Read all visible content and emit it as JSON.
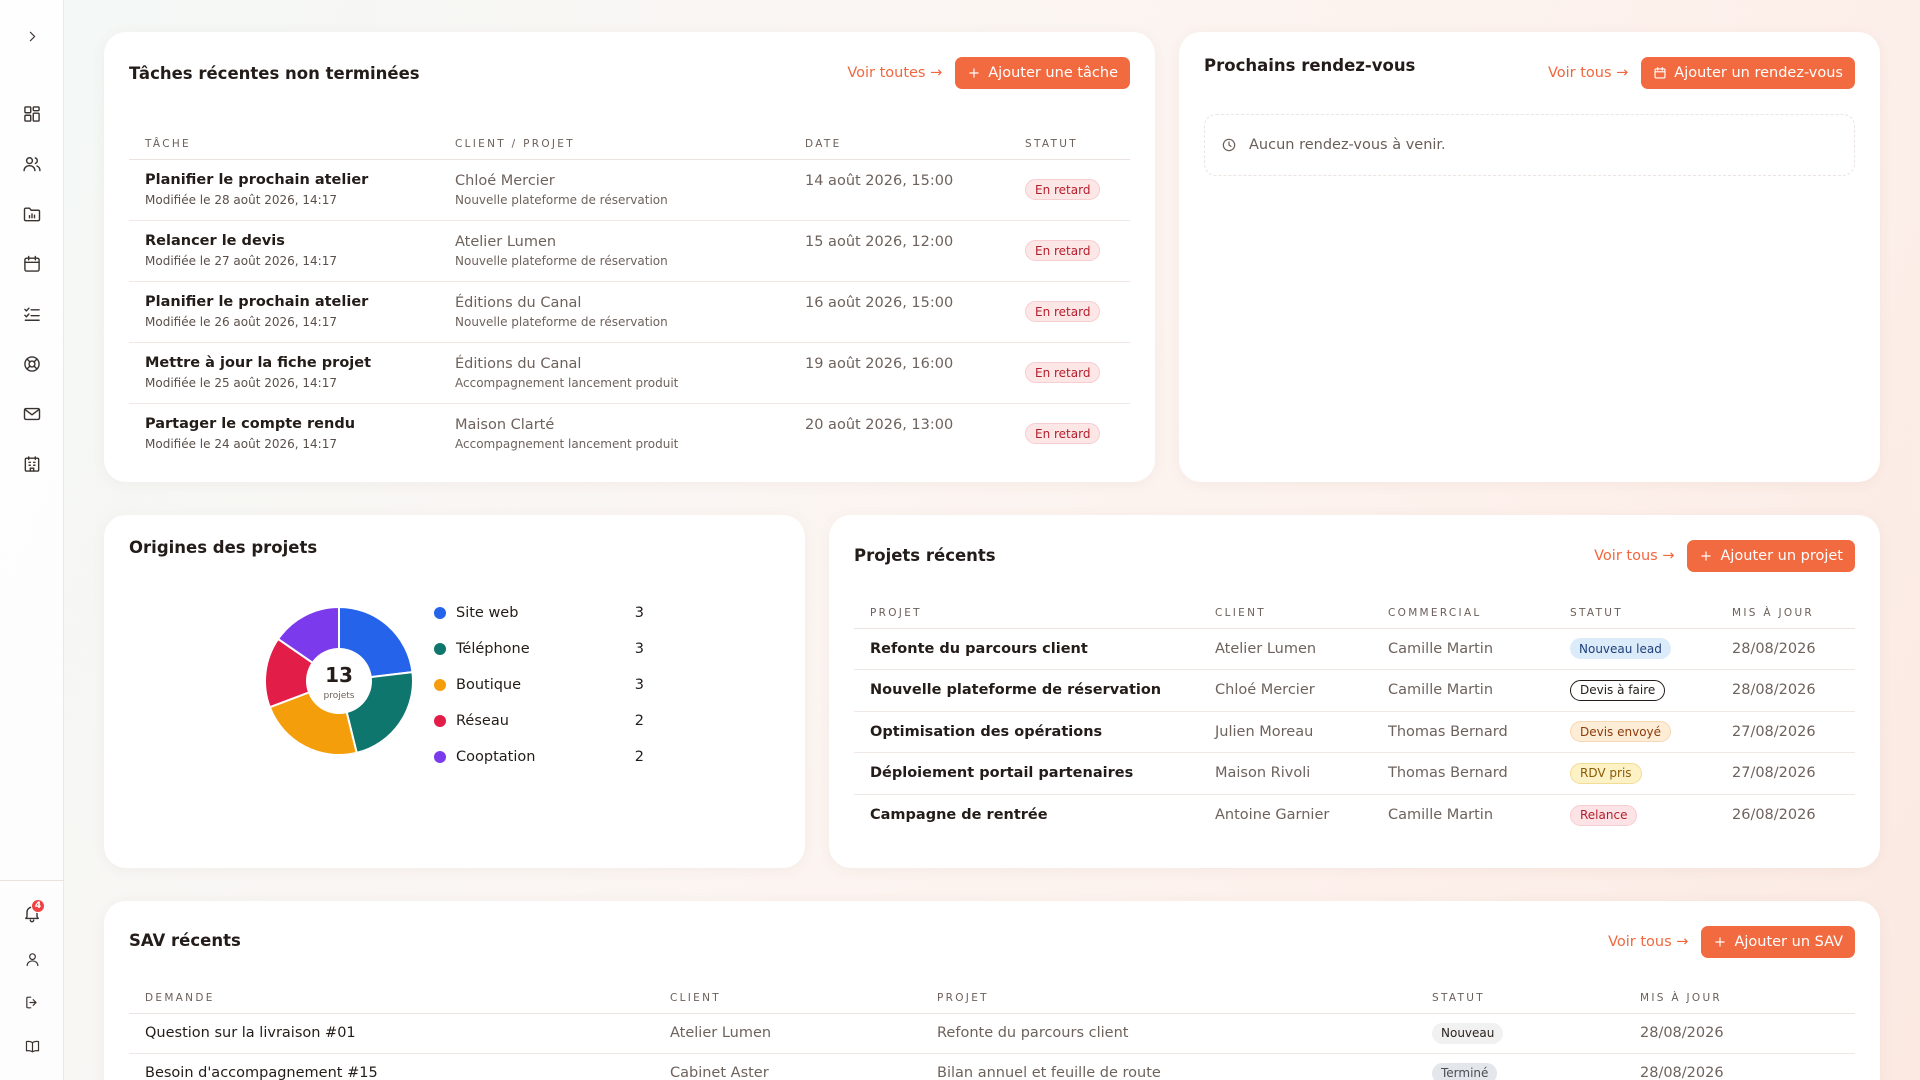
{
  "sidebar": {
    "toggle_icon": "chevron-right-icon",
    "nav": [
      {
        "icon": "dashboard-icon"
      },
      {
        "icon": "users-icon"
      },
      {
        "icon": "folder-chart-icon"
      },
      {
        "icon": "calendar-icon"
      },
      {
        "icon": "checklist-icon"
      },
      {
        "icon": "lifebuoy-icon"
      },
      {
        "icon": "mail-icon"
      },
      {
        "icon": "building-icon"
      }
    ],
    "notifications_count": "4",
    "bottom": [
      {
        "icon": "bell-icon"
      },
      {
        "icon": "user-icon"
      },
      {
        "icon": "logout-icon"
      },
      {
        "icon": "book-icon"
      }
    ]
  },
  "tasks": {
    "title": "Tâches récentes non terminées",
    "view_all": "Voir toutes →",
    "add_label": "Ajouter une tâche",
    "columns": [
      "TÂCHE",
      "CLIENT / PROJET",
      "DATE",
      "STATUT"
    ],
    "rows": [
      {
        "task": "Planifier le prochain atelier",
        "modified": "Modifiée le 28 août 2026, 14:17",
        "client": "Chloé Mercier",
        "project": "Nouvelle plateforme de réservation",
        "date": "14 août 2026, 15:00",
        "status": "En retard"
      },
      {
        "task": "Relancer le devis",
        "modified": "Modifiée le 27 août 2026, 14:17",
        "client": "Atelier Lumen",
        "project": "Nouvelle plateforme de réservation",
        "date": "15 août 2026, 12:00",
        "status": "En retard"
      },
      {
        "task": "Planifier le prochain atelier",
        "modified": "Modifiée le 26 août 2026, 14:17",
        "client": "Éditions du Canal",
        "project": "Nouvelle plateforme de réservation",
        "date": "16 août 2026, 15:00",
        "status": "En retard"
      },
      {
        "task": "Mettre à jour la fiche projet",
        "modified": "Modifiée le 25 août 2026, 14:17",
        "client": "Éditions du Canal",
        "project": "Accompagnement lancement produit",
        "date": "19 août 2026, 16:00",
        "status": "En retard"
      },
      {
        "task": "Partager le compte rendu",
        "modified": "Modifiée le 24 août 2026, 14:17",
        "client": "Maison Clarté",
        "project": "Accompagnement lancement produit",
        "date": "20 août 2026, 13:00",
        "status": "En retard"
      }
    ]
  },
  "appointments": {
    "title": "Prochains rendez-vous",
    "view_all": "Voir tous →",
    "add_label": "Ajouter un rendez-vous",
    "empty_text": "Aucun rendez-vous à venir."
  },
  "origins": {
    "title": "Origines des projets",
    "total": "13",
    "total_label": "projets",
    "colors": [
      "#2563eb",
      "#0f766e",
      "#f59e0b",
      "#e11d48",
      "#7c3aed"
    ]
  },
  "chart_data": {
    "type": "pie",
    "categories": [
      "Site web",
      "Téléphone",
      "Boutique",
      "Réseau",
      "Cooptation"
    ],
    "values": [
      3,
      3,
      3,
      2,
      2
    ]
  },
  "projects": {
    "title": "Projets récents",
    "view_all": "Voir tous →",
    "add_label": "Ajouter un projet",
    "columns": [
      "PROJET",
      "CLIENT",
      "COMMERCIAL",
      "STATUT",
      "MIS À JOUR"
    ],
    "rows": [
      {
        "project": "Refonte du parcours client",
        "client": "Atelier Lumen",
        "sales": "Camille Martin",
        "status": "Nouveau lead",
        "status_kind": "lead",
        "updated": "28/08/2026"
      },
      {
        "project": "Nouvelle plateforme de réservation",
        "client": "Chloé Mercier",
        "sales": "Camille Martin",
        "status": "Devis à faire",
        "status_kind": "devis",
        "updated": "28/08/2026"
      },
      {
        "project": "Optimisation des opérations",
        "client": "Julien Moreau",
        "sales": "Thomas Bernard",
        "status": "Devis envoyé",
        "status_kind": "envoye",
        "updated": "27/08/2026"
      },
      {
        "project": "Déploiement portail partenaires",
        "client": "Maison Rivoli",
        "sales": "Thomas Bernard",
        "status": "RDV pris",
        "status_kind": "rdv",
        "updated": "27/08/2026"
      },
      {
        "project": "Campagne de rentrée",
        "client": "Antoine Garnier",
        "sales": "Camille Martin",
        "status": "Relance",
        "status_kind": "relance",
        "updated": "26/08/2026"
      }
    ]
  },
  "sav": {
    "title": "SAV récents",
    "view_all": "Voir tous →",
    "add_label": "Ajouter un SAV",
    "columns": [
      "DEMANDE",
      "CLIENT",
      "PROJET",
      "STATUT",
      "MIS À JOUR"
    ],
    "rows": [
      {
        "request": "Question sur la livraison #01",
        "client": "Atelier Lumen",
        "project": "Refonte du parcours client",
        "status": "Nouveau",
        "status_kind": "nouveau",
        "updated": "28/08/2026"
      },
      {
        "request": "Besoin d'accompagnement #15",
        "client": "Cabinet Aster",
        "project": "Bilan annuel et feuille de route",
        "status": "Terminé",
        "status_kind": "termine",
        "updated": "28/08/2026"
      }
    ]
  }
}
